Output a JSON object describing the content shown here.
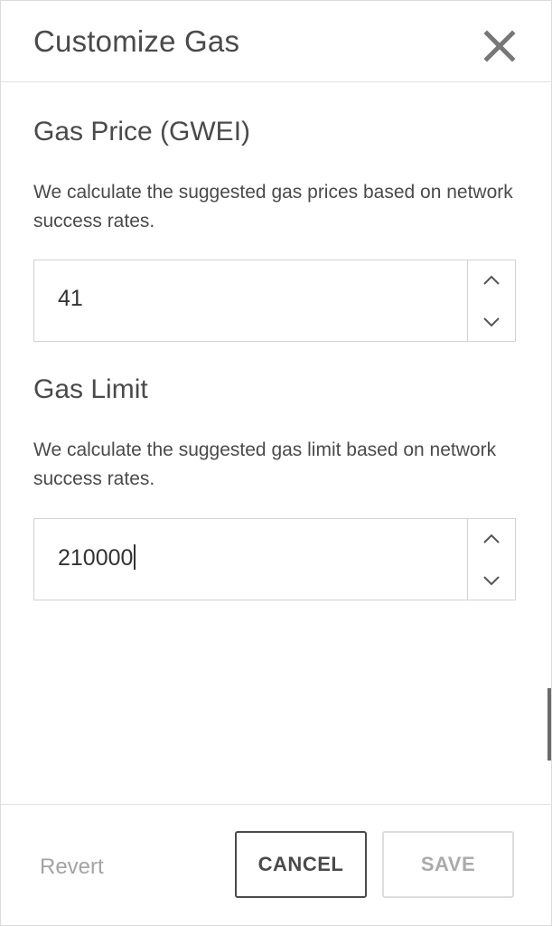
{
  "header": {
    "title": "Customize Gas"
  },
  "gas_price": {
    "title": "Gas Price (GWEI)",
    "description": "We calculate the suggested gas prices based on network success rates.",
    "value": "41"
  },
  "gas_limit": {
    "title": "Gas Limit",
    "description": "We calculate the suggested gas limit based on network success rates.",
    "value": "210000"
  },
  "footer": {
    "revert_label": "Revert",
    "cancel_label": "CANCEL",
    "save_label": "SAVE"
  },
  "icons": {
    "close": "close-icon",
    "up": "chevron-up-icon",
    "down": "chevron-down-icon"
  },
  "colors": {
    "text": "#4a4a4a",
    "border": "#d2d2d2",
    "disabled": "#aaaaaa"
  }
}
